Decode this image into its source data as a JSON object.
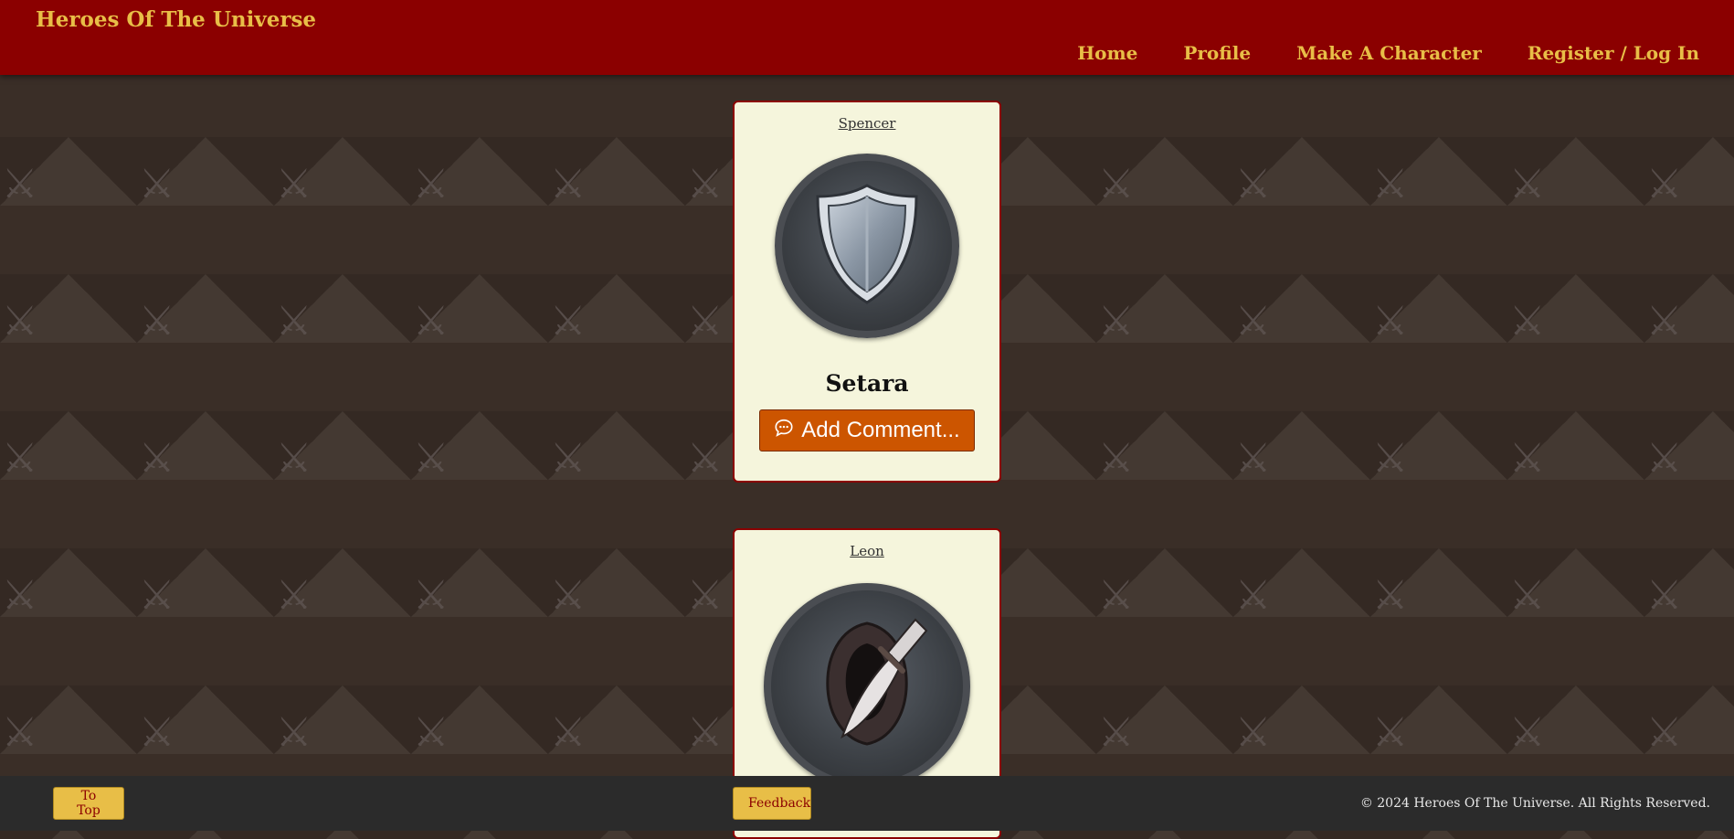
{
  "header": {
    "title": "Heroes Of The Universe",
    "nav": [
      {
        "label": "Home"
      },
      {
        "label": "Profile"
      },
      {
        "label": "Make A Character"
      },
      {
        "label": "Register / Log In"
      }
    ]
  },
  "cards": [
    {
      "owner": "Spencer",
      "character_name": "Setara",
      "avatar_icon": "shield-icon",
      "comment_label": "Add Comment..."
    },
    {
      "owner": "Leon",
      "avatar_icon": "hooded-rogue-dagger-icon"
    }
  ],
  "footer": {
    "to_top_label": "To Top",
    "feedback_label": "Feedback",
    "copyright": "© 2024 Heroes Of The Universe. All Rights Reserved."
  },
  "colors": {
    "header_bg": "#8b0000",
    "accent_gold": "#e8be47",
    "card_bg": "#f5f5dc",
    "comment_button": "#cc5500",
    "footer_bg": "#2b2b2b",
    "page_bg": "#3a2e27"
  }
}
